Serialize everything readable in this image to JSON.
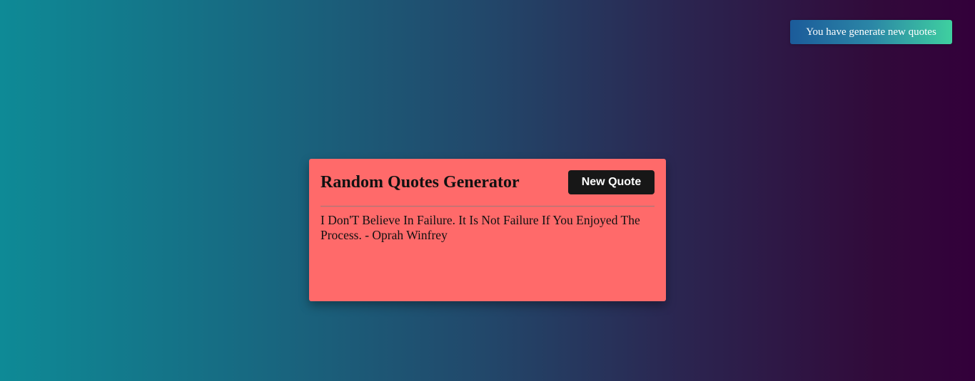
{
  "toast": {
    "message": "You have generate new quotes"
  },
  "card": {
    "title": "Random Quotes Generator",
    "new_quote_label": "New Quote",
    "quote_text": "I Don'T Believe In Failure. It Is Not Failure If You Enjoyed The Process.",
    "quote_separator": " - ",
    "quote_author": "Oprah Winfrey"
  },
  "colors": {
    "card_background": "#ff6a6a",
    "button_background": "#171717",
    "toast_gradient_start": "#1b5b9a",
    "toast_gradient_end": "#3fd0a0",
    "page_gradient_start": "#0e8a96",
    "page_gradient_end": "#33003a"
  }
}
